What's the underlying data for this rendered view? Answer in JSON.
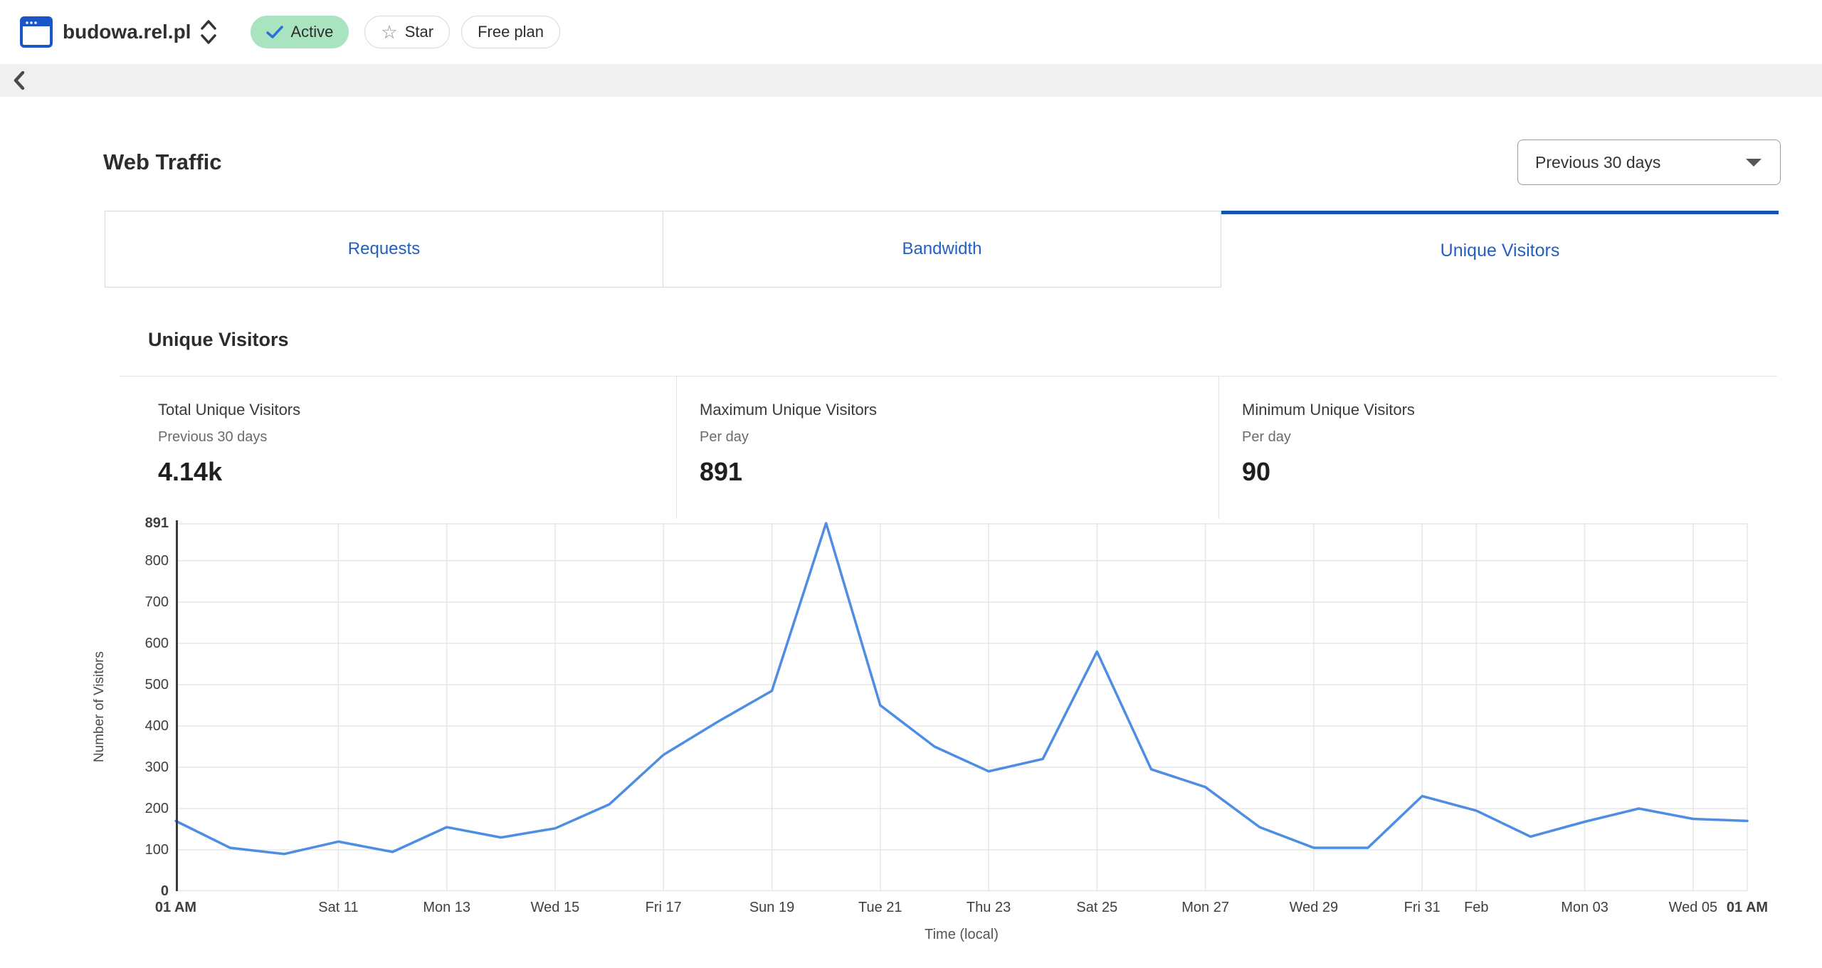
{
  "header": {
    "site_name": "budowa.rel.pl",
    "status_badge": "Active",
    "star_label": "Star",
    "star_glyph": "☆",
    "plan_badge": "Free plan",
    "badge_green": "#a9e4c1",
    "check_color": "#2d6fd6"
  },
  "page": {
    "title": "Web Traffic",
    "range_selector": "Previous 30 days"
  },
  "tabs": [
    {
      "label": "Requests",
      "active": false
    },
    {
      "label": "Bandwidth",
      "active": false
    },
    {
      "label": "Unique Visitors",
      "active": true
    }
  ],
  "panel": {
    "heading": "Unique Visitors",
    "stats": [
      {
        "label": "Total Unique Visitors",
        "sub": "Previous 30 days",
        "value": "4.14k"
      },
      {
        "label": "Maximum Unique Visitors",
        "sub": "Per day",
        "value": "891"
      },
      {
        "label": "Minimum Unique Visitors",
        "sub": "Per day",
        "value": "90"
      }
    ]
  },
  "chart_data": {
    "type": "line",
    "series_name": "Unique Visitors per day",
    "x_days": [
      "Jan 8",
      "Jan 9",
      "Jan 10",
      "Jan 11",
      "Jan 12",
      "Jan 13",
      "Jan 14",
      "Jan 15",
      "Jan 16",
      "Jan 17",
      "Jan 18",
      "Jan 19",
      "Jan 20",
      "Jan 21",
      "Jan 22",
      "Jan 23",
      "Jan 24",
      "Jan 25",
      "Jan 26",
      "Jan 27",
      "Jan 28",
      "Jan 29",
      "Jan 30",
      "Jan 31",
      "Feb 1",
      "Feb 2",
      "Feb 3",
      "Feb 4",
      "Feb 5",
      "Feb 6"
    ],
    "values": [
      170,
      105,
      90,
      120,
      95,
      155,
      130,
      152,
      210,
      330,
      410,
      485,
      891,
      450,
      350,
      290,
      320,
      580,
      295,
      252,
      155,
      105,
      105,
      230,
      195,
      132,
      168,
      200,
      175,
      170
    ],
    "ylim": [
      0,
      891
    ],
    "yticks": [
      0,
      100,
      200,
      300,
      400,
      500,
      600,
      700,
      800,
      891
    ],
    "ybold": [
      0,
      891
    ],
    "xticks": [
      {
        "label": "01 AM",
        "day": 0,
        "bold": true
      },
      {
        "label": "Sat 11",
        "day": 3
      },
      {
        "label": "Mon 13",
        "day": 5
      },
      {
        "label": "Wed 15",
        "day": 7
      },
      {
        "label": "Fri 17",
        "day": 9
      },
      {
        "label": "Sun 19",
        "day": 11
      },
      {
        "label": "Tue 21",
        "day": 13
      },
      {
        "label": "Thu 23",
        "day": 15
      },
      {
        "label": "Sat 25",
        "day": 17
      },
      {
        "label": "Mon 27",
        "day": 19
      },
      {
        "label": "Wed 29",
        "day": 21
      },
      {
        "label": "Fri 31",
        "day": 23
      },
      {
        "label": "Feb",
        "day": 24
      },
      {
        "label": "Mon 03",
        "day": 26
      },
      {
        "label": "Wed 05",
        "day": 28
      },
      {
        "label": "01 AM",
        "day": 29,
        "bold": true
      }
    ],
    "xlabel": "Time (local)",
    "ylabel": "Number of Visitors",
    "grid_on": true,
    "legend": "none",
    "line_color": "#4d8de3",
    "grid_color": "#e7e7e7",
    "axis_color": "#3b3b3b"
  }
}
